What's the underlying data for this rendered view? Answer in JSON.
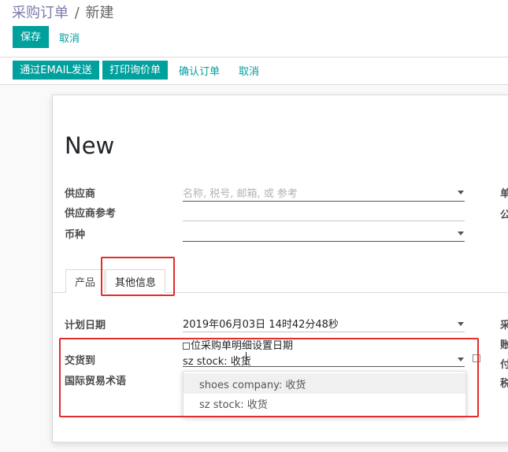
{
  "breadcrumb": {
    "parent": "采购订单",
    "separator": "/",
    "current": "新建"
  },
  "control": {
    "save": "保存",
    "discard": "取消"
  },
  "statusbar": {
    "send_email": "通过EMAIL发送",
    "print_rfq": "打印询价单",
    "confirm": "确认订单",
    "cancel": "取消"
  },
  "form": {
    "name": "New",
    "vendor_label": "供应商",
    "vendor_placeholder": "名称, 税号, 邮箱, 或 参考",
    "vendor_ref_label": "供应商参考",
    "currency_label": "币种",
    "right_labels": [
      "单",
      "公"
    ]
  },
  "tabs": {
    "products": "产品",
    "other_info": "其他信息"
  },
  "other_info": {
    "planned_date_label": "计划日期",
    "planned_date_value": "2019年06月03日 14时42分48秒",
    "set_date_hint": "位采购单明细设置日期",
    "deliver_to_label": "交货到",
    "deliver_to_value": "sz stock: 收货",
    "incoterm_label": "国际贸易术语",
    "right_labels": [
      "采",
      "账",
      "付",
      "税"
    ]
  },
  "dropdown": {
    "options": [
      "shoes company: 收货",
      "sz stock: 收货"
    ]
  }
}
